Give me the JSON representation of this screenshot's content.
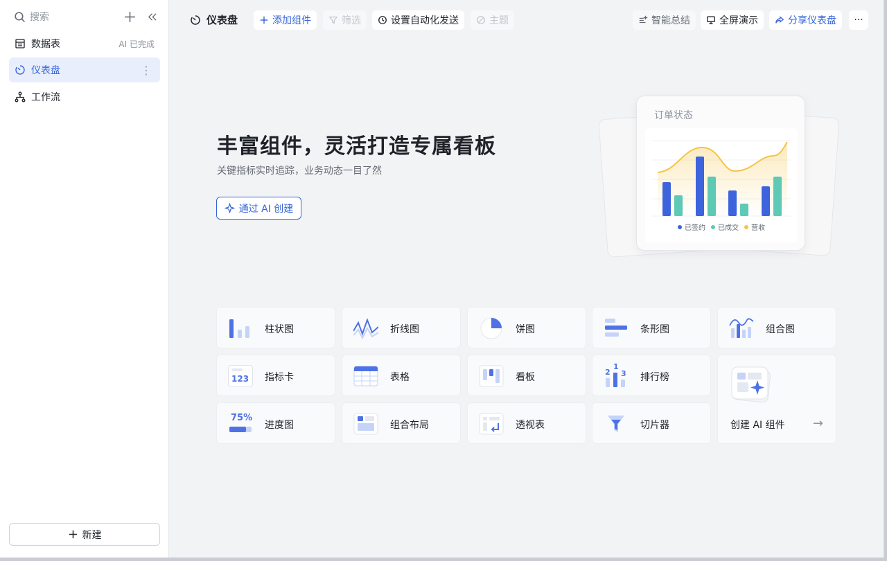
{
  "sidebar": {
    "search_placeholder": "搜索",
    "items": [
      {
        "label": "数据表",
        "meta": "AI 已完成"
      },
      {
        "label": "仪表盘"
      },
      {
        "label": "工作流"
      }
    ],
    "new_label": "新建"
  },
  "toolbar": {
    "title": "仪表盘",
    "add_widget": "添加组件",
    "filter": "筛选",
    "automation": "设置自动化发送",
    "theme": "主题",
    "summary": "智能总结",
    "fullscreen": "全屏演示",
    "share": "分享仪表盘",
    "more": "···"
  },
  "hero": {
    "title": "丰富组件，灵活打造专属看板",
    "subtitle": "关键指标实时追踪，业务动态一目了然",
    "ai_button": "通过 AI 创建"
  },
  "illustration": {
    "title": "订单状态",
    "legend": [
      "已签约",
      "已成交",
      "营收"
    ],
    "colors": {
      "signed": "#3d64dd",
      "closed": "#5ec9b5",
      "revenue": "#f5c445"
    }
  },
  "widgets": [
    {
      "label": "柱状图",
      "icon": "bar-chart-icon"
    },
    {
      "label": "折线图",
      "icon": "line-chart-icon"
    },
    {
      "label": "饼图",
      "icon": "pie-chart-icon"
    },
    {
      "label": "条形图",
      "icon": "horizontal-bar-icon"
    },
    {
      "label": "组合图",
      "icon": "combo-chart-icon"
    },
    {
      "label": "指标卡",
      "icon": "metric-card-icon",
      "icon_text": "123"
    },
    {
      "label": "表格",
      "icon": "table-icon"
    },
    {
      "label": "看板",
      "icon": "kanban-icon"
    },
    {
      "label": "排行榜",
      "icon": "leaderboard-icon",
      "icon_text": [
        "1",
        "2",
        "3"
      ]
    },
    {
      "label": "进度图",
      "icon": "progress-icon",
      "icon_text": "75%"
    },
    {
      "label": "组合布局",
      "icon": "layout-icon"
    },
    {
      "label": "透视表",
      "icon": "pivot-table-icon"
    },
    {
      "label": "切片器",
      "icon": "slicer-icon"
    }
  ],
  "ai_widget": {
    "label": "创建 AI 组件",
    "arrow": "→"
  }
}
